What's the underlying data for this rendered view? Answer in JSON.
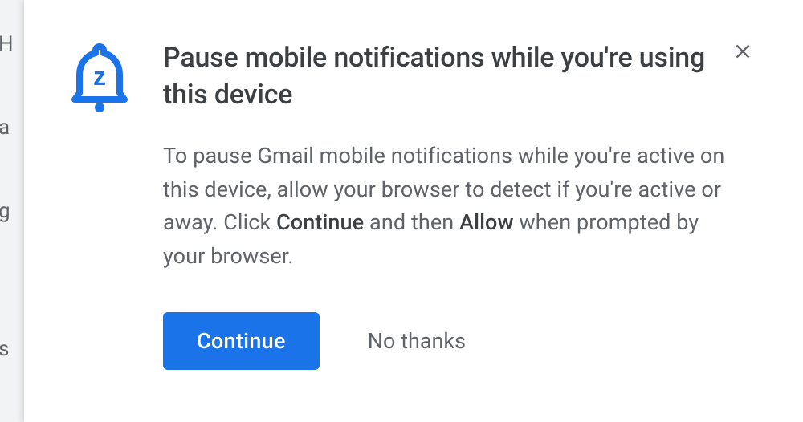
{
  "dialog": {
    "title": "Pause mobile notifications while you're using this device",
    "description_parts": {
      "p1": "To pause Gmail mobile notifications while you're active on this device, allow your browser to detect if you're active or away. Click ",
      "b1": "Continue",
      "p2": " and then ",
      "b2": "Allow",
      "p3": " when prompted by your browser."
    },
    "continue_label": "Continue",
    "no_thanks_label": "No thanks"
  },
  "background": {
    "items": [
      "H",
      "a",
      "g",
      "s"
    ]
  },
  "colors": {
    "primary": "#1a73e8",
    "text_primary": "#3c4043",
    "text_secondary": "#5f6368"
  }
}
